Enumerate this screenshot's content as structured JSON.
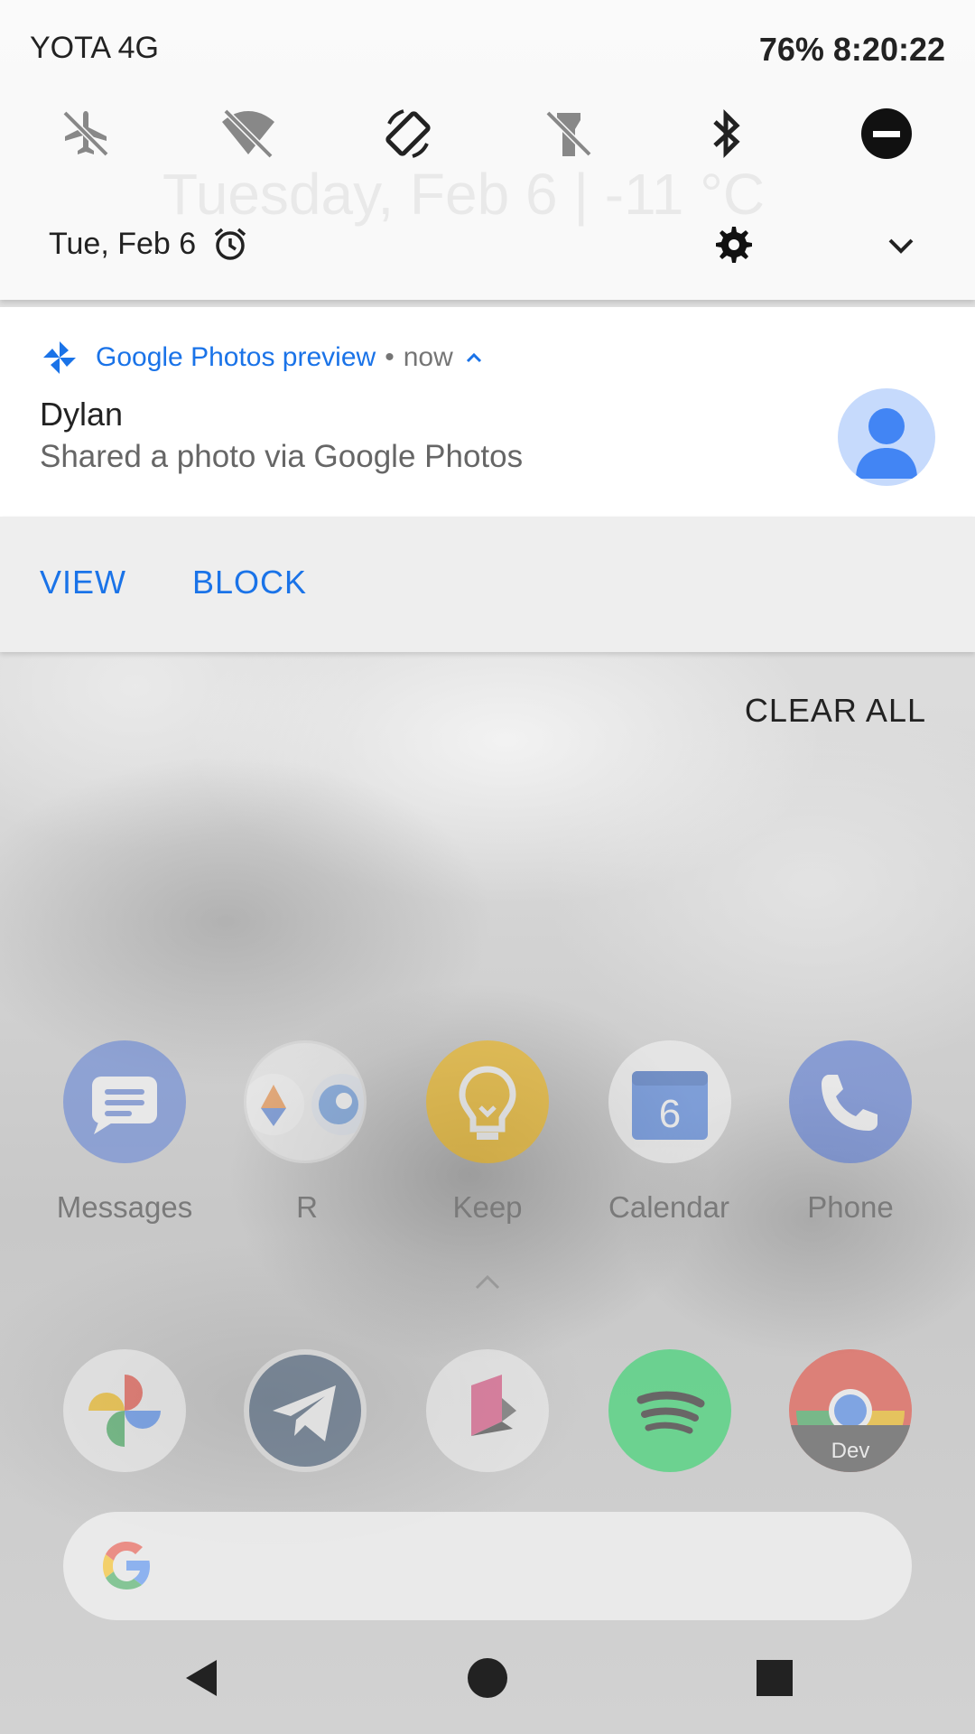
{
  "status_bar": {
    "carrier": "YOTA 4G",
    "battery": "76%",
    "time": "8:20:22"
  },
  "quick_settings": {
    "background_date_weather": "Tuesday, Feb 6  |       -11 °C",
    "date": "Tue, Feb 6",
    "tiles": [
      "airplane-mode-off",
      "wifi-off",
      "auto-rotate",
      "flashlight-off",
      "bluetooth",
      "do-not-disturb"
    ]
  },
  "notification": {
    "app_name": "Google Photos preview",
    "separator": "•",
    "time": "now",
    "title": "Dylan",
    "body": "Shared a photo via Google Photos",
    "actions": {
      "view": "VIEW",
      "block": "BLOCK"
    },
    "accent_color": "#1a73e8"
  },
  "clear_all": "CLEAR ALL",
  "home": {
    "apps_row": [
      {
        "label": "Messages"
      },
      {
        "label": "R"
      },
      {
        "label": "Keep"
      },
      {
        "label": "Calendar",
        "badge": "6"
      },
      {
        "label": "Phone"
      }
    ],
    "dock": [
      {
        "icon": "google-photos-icon"
      },
      {
        "icon": "telegram-icon"
      },
      {
        "icon": "shape-app-icon"
      },
      {
        "icon": "spotify-icon"
      },
      {
        "icon": "chrome-dev-icon",
        "badge": "Dev"
      }
    ]
  },
  "nav": [
    "back",
    "home",
    "recents"
  ]
}
